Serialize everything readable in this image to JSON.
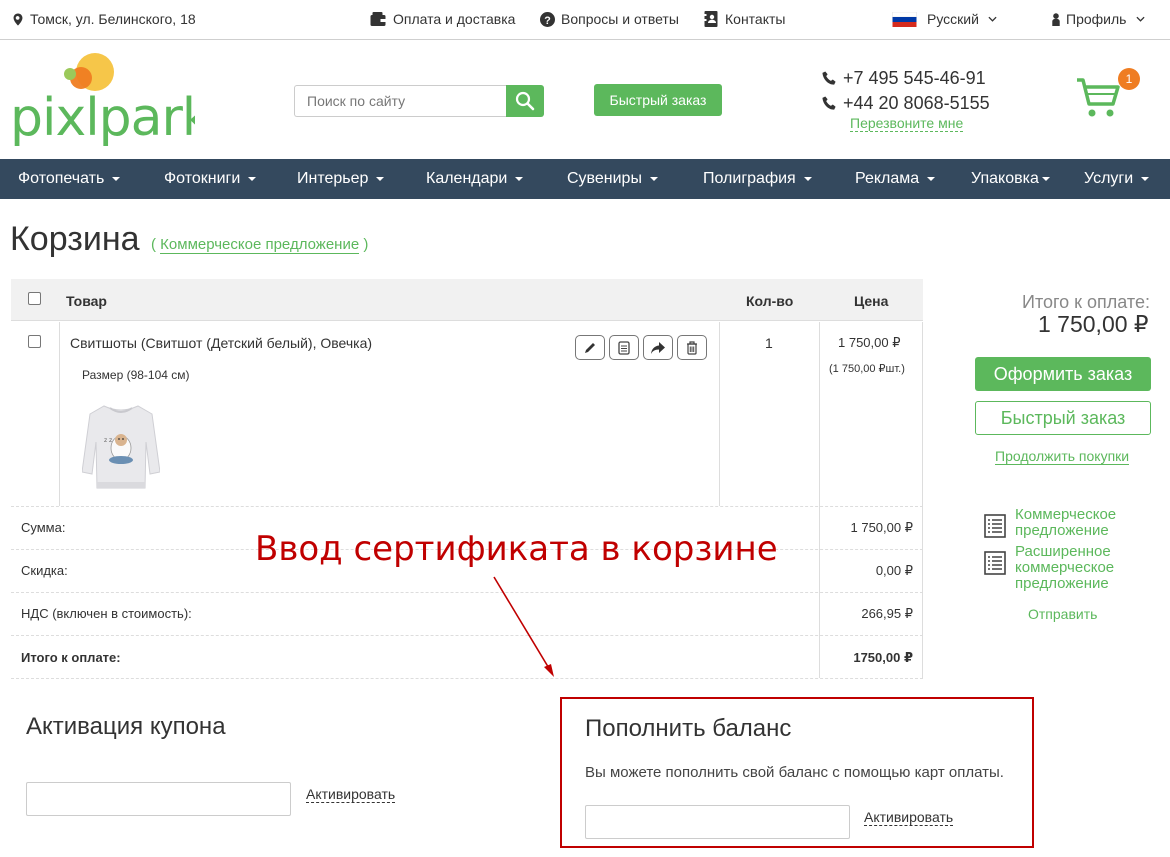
{
  "topbar": {
    "address": "Томск, ул. Белинского, 18",
    "payment": "Оплата и доставка",
    "faq": "Вопросы и ответы",
    "contacts": "Контакты",
    "language": "Русский",
    "profile": "Профиль"
  },
  "header": {
    "logo_text": "pixlpark",
    "search_placeholder": "Поиск по сайту",
    "quick_order": "Быстрый заказ",
    "phone1": "+7 495 545-46-91",
    "phone2": "+44 20 8068-5155",
    "callback": "Перезвоните мне",
    "cart_count": "1"
  },
  "nav": {
    "items": [
      "Фотопечать",
      "Фотокниги",
      "Интерьер",
      "Календари",
      "Сувениры",
      "Полиграфия",
      "Реклама",
      "Упаковка",
      "Услуги"
    ]
  },
  "page": {
    "title": "Корзина",
    "sub_open": "(",
    "sub_link": "Коммерческое предложение",
    "sub_close": ")"
  },
  "table": {
    "headers": {
      "product": "Товар",
      "qty": "Кол-во",
      "price": "Цена"
    },
    "item": {
      "name": "Свитшоты (Свитшот (Детский белый), Овечка)",
      "size": "Размер (98-104 см)",
      "qty": "1",
      "price": "1 750,00 ₽",
      "unit_price": "(1 750,00 ₽шт.)"
    },
    "summary": [
      {
        "label": "Сумма:",
        "value": "1 750,00 ₽"
      },
      {
        "label": "Скидка:",
        "value": "0,00 ₽"
      },
      {
        "label": "НДС (включен в стоимость):",
        "value": "266,95 ₽"
      },
      {
        "label": "Итого к оплате:",
        "value": "1750,00 ₽"
      }
    ]
  },
  "sidebar": {
    "total_label": "Итого к оплате:",
    "total_value": "1 750,00 ₽",
    "order_button": "Оформить заказ",
    "quick_button": "Быстрый заказ",
    "continue": "Продолжить покупки",
    "offer1": "Коммерческое предложение",
    "offer2": "Расширенное коммерческое предложение",
    "send": "Отправить"
  },
  "annotation": "Ввод сертификата в корзине",
  "coupon": {
    "title": "Активация купона",
    "activate": "Активировать"
  },
  "balance": {
    "title": "Пополнить баланс",
    "description": "Вы можете пополнить свой баланс с помощью карт оплаты.",
    "activate": "Активировать"
  },
  "colors": {
    "brand_green": "#5cb85c",
    "nav_bg": "#34495e",
    "badge_orange": "#ef7d22",
    "annotation_red": "#c00000"
  }
}
